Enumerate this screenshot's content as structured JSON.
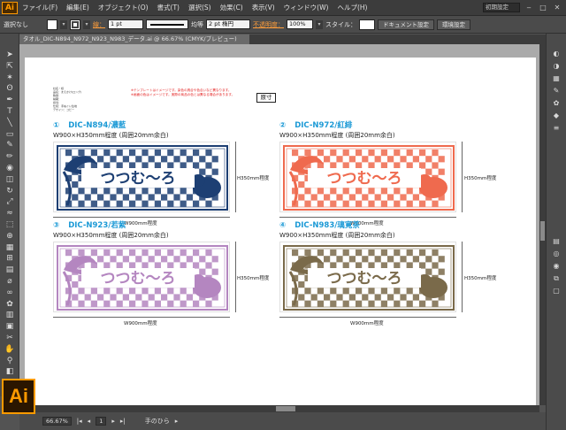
{
  "app": {
    "logo_text": "Ai"
  },
  "menubar": {
    "items": [
      "ファイル(F)",
      "編集(E)",
      "オブジェクト(O)",
      "書式(T)",
      "選択(S)",
      "効果(C)",
      "表示(V)",
      "ウィンドウ(W)",
      "ヘルプ(H)"
    ],
    "workspace": "初期設定"
  },
  "controlbar": {
    "selection_label": "選択なし",
    "stroke_label": "線：",
    "stroke_weight": "1 pt",
    "stroke_style": "均等",
    "brush": "2 pt 楕円",
    "opacity_label": "不透明度：",
    "opacity_value": "100%",
    "style_label": "スタイル：",
    "doc_settings_button": "ドキュメント設定",
    "env_settings_button": "環境設定"
  },
  "document": {
    "tab_title": "タオル_DIC-N894_N972_N923_N983_データ.ai @ 66.67% (CMYK/プレビュー)"
  },
  "artboard": {
    "notes": [
      "社名・様",
      "品名：まえかけ(ロング)",
      "数量：",
      "納期：",
      "担当：",
      "仕様：手ぬぐい生地",
      "デザイン：コピー"
    ],
    "warning_lines": [
      "※テンプレートはイメージです。染色の具合や色合いなど異なります。",
      "※画面の色はイメージです。実際の商品の色とは異なる場合があります。"
    ],
    "original_size_label": "原寸",
    "items": [
      {
        "num": "①",
        "code": "DIC-N894/濃藍",
        "size": "W900×H350mm程度 (周囲20mm余白)",
        "width_label": "W900mm程度",
        "height_label": "H350mm程度",
        "color": "#1d3f73"
      },
      {
        "num": "②",
        "code": "DIC-N972/紅緋",
        "size": "W900×H350mm程度 (周囲20mm余白)",
        "width_label": "W900mm程度",
        "height_label": "H350mm程度",
        "color": "#ef6a4e"
      },
      {
        "num": "③",
        "code": "DIC-N923/若紫",
        "size": "W900×H350mm程度 (周囲20mm余白)",
        "width_label": "W900mm程度",
        "height_label": "H350mm程度",
        "color": "#b486c0"
      },
      {
        "num": "④",
        "code": "DIC-N983/璃寛茶",
        "size": "W900×H350mm程度 (周囲20mm余白)",
        "width_label": "W900mm程度",
        "height_label": "H350mm程度",
        "color": "#7a6a4a"
      }
    ]
  },
  "statusbar": {
    "zoom": "66.67%",
    "page": "1",
    "tool": "手のひら"
  },
  "tools_left": [
    "selection-tool",
    "direct-selection-tool",
    "magic-wand-tool",
    "lasso-tool",
    "pen-tool",
    "type-tool",
    "line-tool",
    "rectangle-tool",
    "paintbrush-tool",
    "pencil-tool",
    "blob-brush-tool",
    "eraser-tool",
    "rotate-tool",
    "scale-tool",
    "width-tool",
    "free-transform-tool",
    "shape-builder-tool",
    "perspective-tool",
    "mesh-tool",
    "gradient-tool",
    "eyedropper-tool",
    "blend-tool",
    "symbol-sprayer-tool",
    "graph-tool",
    "artboard-tool",
    "slice-tool",
    "hand-tool",
    "zoom-tool",
    "fill-stroke-swatch",
    "draw-mode"
  ],
  "tools_right": [
    "color-panel",
    "color-guide-panel",
    "swatches-panel",
    "brushes-panel",
    "symbols-panel",
    "graphic-styles-panel",
    "stroke-panel",
    "gradient-panel",
    "transparency-panel",
    "appearance-panel",
    "layers-panel",
    "artboards-panel"
  ]
}
